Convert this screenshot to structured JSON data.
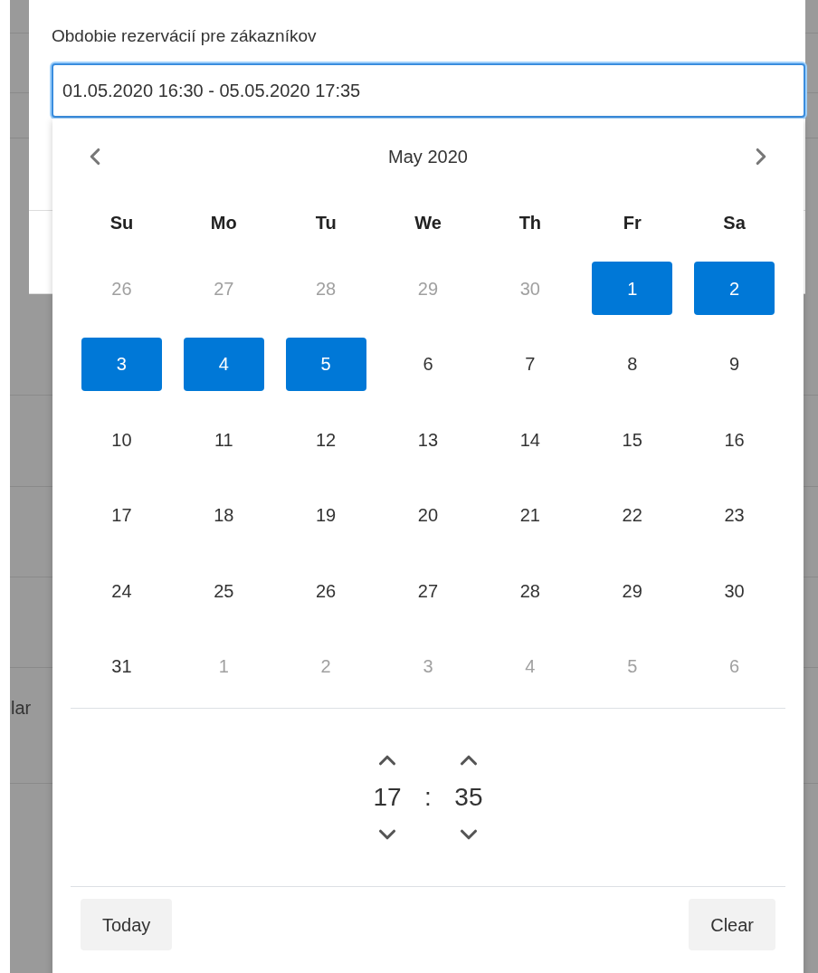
{
  "background": {
    "row_text": "lar"
  },
  "dialog": {
    "label": "Obdobie rezervácií pre zákazníkov",
    "field": {
      "value": "01.05.2020 16:30 - 05.05.2020 17:35"
    }
  },
  "picker": {
    "month": "May 2020",
    "weekdays": [
      "Su",
      "Mo",
      "Tu",
      "We",
      "Th",
      "Fr",
      "Sa"
    ],
    "days": [
      {
        "text": "26",
        "muted": true,
        "selected": false
      },
      {
        "text": "27",
        "muted": true,
        "selected": false
      },
      {
        "text": "28",
        "muted": true,
        "selected": false
      },
      {
        "text": "29",
        "muted": true,
        "selected": false
      },
      {
        "text": "30",
        "muted": true,
        "selected": false
      },
      {
        "text": "1",
        "muted": false,
        "selected": true
      },
      {
        "text": "2",
        "muted": false,
        "selected": true
      },
      {
        "text": "3",
        "muted": false,
        "selected": true
      },
      {
        "text": "4",
        "muted": false,
        "selected": true
      },
      {
        "text": "5",
        "muted": false,
        "selected": true
      },
      {
        "text": "6",
        "muted": false,
        "selected": false
      },
      {
        "text": "7",
        "muted": false,
        "selected": false
      },
      {
        "text": "8",
        "muted": false,
        "selected": false
      },
      {
        "text": "9",
        "muted": false,
        "selected": false
      },
      {
        "text": "10",
        "muted": false,
        "selected": false
      },
      {
        "text": "11",
        "muted": false,
        "selected": false
      },
      {
        "text": "12",
        "muted": false,
        "selected": false
      },
      {
        "text": "13",
        "muted": false,
        "selected": false
      },
      {
        "text": "14",
        "muted": false,
        "selected": false
      },
      {
        "text": "15",
        "muted": false,
        "selected": false
      },
      {
        "text": "16",
        "muted": false,
        "selected": false
      },
      {
        "text": "17",
        "muted": false,
        "selected": false
      },
      {
        "text": "18",
        "muted": false,
        "selected": false
      },
      {
        "text": "19",
        "muted": false,
        "selected": false
      },
      {
        "text": "20",
        "muted": false,
        "selected": false
      },
      {
        "text": "21",
        "muted": false,
        "selected": false
      },
      {
        "text": "22",
        "muted": false,
        "selected": false
      },
      {
        "text": "23",
        "muted": false,
        "selected": false
      },
      {
        "text": "24",
        "muted": false,
        "selected": false
      },
      {
        "text": "25",
        "muted": false,
        "selected": false
      },
      {
        "text": "26",
        "muted": false,
        "selected": false
      },
      {
        "text": "27",
        "muted": false,
        "selected": false
      },
      {
        "text": "28",
        "muted": false,
        "selected": false
      },
      {
        "text": "29",
        "muted": false,
        "selected": false
      },
      {
        "text": "30",
        "muted": false,
        "selected": false
      },
      {
        "text": "31",
        "muted": false,
        "selected": false
      },
      {
        "text": "1",
        "muted": true,
        "selected": false
      },
      {
        "text": "2",
        "muted": true,
        "selected": false
      },
      {
        "text": "3",
        "muted": true,
        "selected": false
      },
      {
        "text": "4",
        "muted": true,
        "selected": false
      },
      {
        "text": "5",
        "muted": true,
        "selected": false
      },
      {
        "text": "6",
        "muted": true,
        "selected": false
      }
    ],
    "time": {
      "hours": "17",
      "separator": ":",
      "minutes": "35"
    },
    "buttons": [
      "Today",
      "Clear"
    ]
  }
}
